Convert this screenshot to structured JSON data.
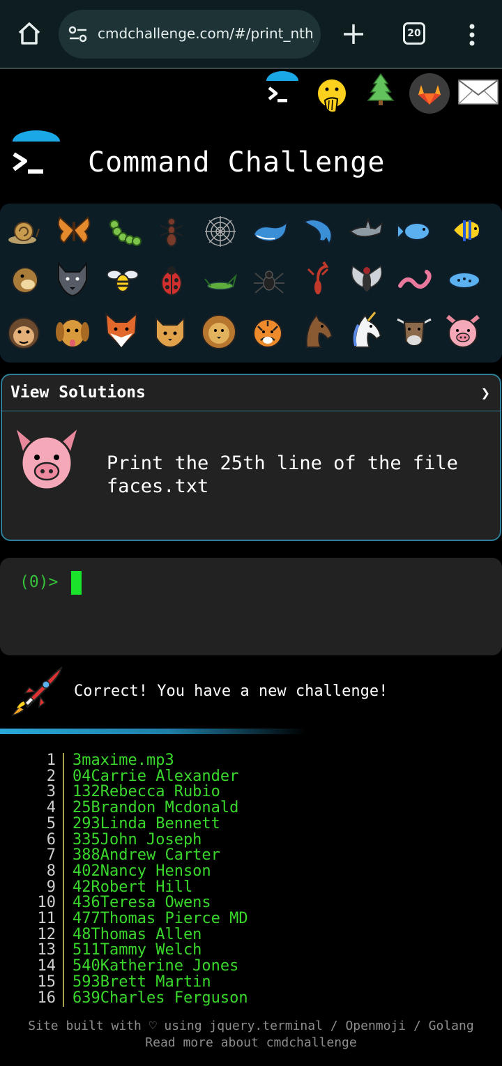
{
  "browser": {
    "url": "cmdchallenge.com/#/print_nth_",
    "tab_count": "20"
  },
  "header": {
    "title": "Command Challenge",
    "top_icons": [
      "terminal-icon",
      "face-with-hand-over-mouth-icon",
      "tree-icon",
      "gitlab-icon",
      "mail-icon"
    ]
  },
  "animals": [
    "snail",
    "butterfly",
    "caterpillar",
    "ant",
    "spider-web",
    "whale",
    "dolphin",
    "shark",
    "fish",
    "tropical-fish",
    "blowfish",
    "wolf",
    "bee",
    "ladybug",
    "cricket",
    "spider",
    "scorpion",
    "fly",
    "worm",
    "microbe",
    "monkey",
    "dog",
    "fox",
    "cat",
    "lion",
    "tiger",
    "horse",
    "unicorn",
    "cow",
    "pig"
  ],
  "solutions": {
    "header_label": "View Solutions",
    "chevron": "❯",
    "challenge_line1": "Print the 25th line of the file",
    "challenge_line2": "faces.txt"
  },
  "terminal": {
    "prompt": "(0)>"
  },
  "status": {
    "message": "Correct! You have a new challenge!"
  },
  "output": [
    {
      "n": "1",
      "t": "3maxime.mp3"
    },
    {
      "n": "2",
      "t": "04Carrie Alexander"
    },
    {
      "n": "3",
      "t": "132Rebecca Rubio"
    },
    {
      "n": "4",
      "t": "25Brandon Mcdonald"
    },
    {
      "n": "5",
      "t": "293Linda Bennett"
    },
    {
      "n": "6",
      "t": "335John Joseph"
    },
    {
      "n": "7",
      "t": "388Andrew Carter"
    },
    {
      "n": "8",
      "t": "402Nancy Henson"
    },
    {
      "n": "9",
      "t": "42Robert Hill"
    },
    {
      "n": "10",
      "t": "436Teresa Owens"
    },
    {
      "n": "11",
      "t": "477Thomas Pierce MD"
    },
    {
      "n": "12",
      "t": "48Thomas Allen"
    },
    {
      "n": "13",
      "t": "511Tammy Welch"
    },
    {
      "n": "14",
      "t": "540Katherine Jones"
    },
    {
      "n": "15",
      "t": "593Brett Martin"
    },
    {
      "n": "16",
      "t": "639Charles Ferguson"
    }
  ],
  "footer": {
    "line1": "Site built with ♡ using jquery.terminal / Openmoji / Golang",
    "line2": "Read more about cmdchallenge"
  }
}
